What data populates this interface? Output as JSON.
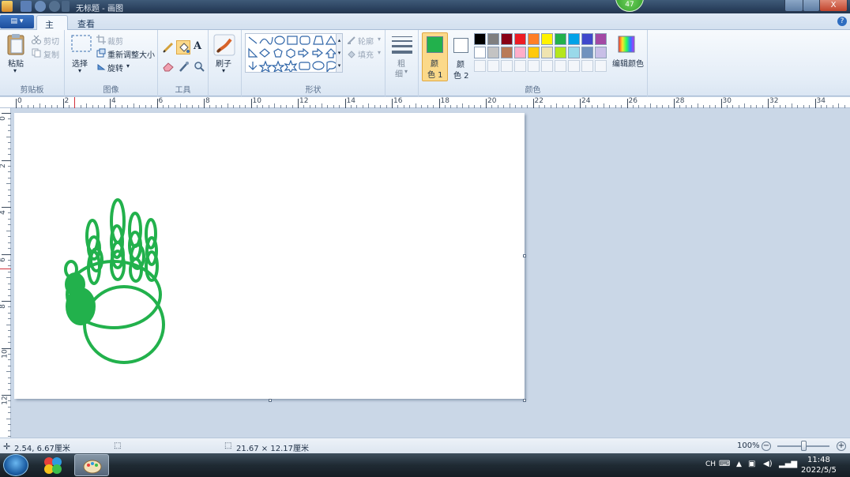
{
  "window": {
    "title": "无标题 - 画图",
    "notification_count": "47",
    "close_label": "X"
  },
  "app_menu_label": "▤ ▾",
  "tabs": [
    {
      "label": "主页"
    },
    {
      "label": "查看"
    }
  ],
  "help_label": "?",
  "ribbon": {
    "clipboard": {
      "paste": "粘贴",
      "cut": "剪切",
      "copy": "复制",
      "label": "剪贴板"
    },
    "image": {
      "select": "选择",
      "crop": "裁剪",
      "resize": "重新调整大小",
      "rotate": "旋转",
      "label": "图像"
    },
    "tools": {
      "label": "工具"
    },
    "brushes": {
      "label": "刷子"
    },
    "shapes": {
      "outline": "轮廓",
      "fill": "填充",
      "label": "形状"
    },
    "size": {
      "label_line1": "粗",
      "label_line2": "细"
    },
    "colors": {
      "color1_line1": "颜",
      "color1_line2": "色 1",
      "color2_line1": "颜",
      "color2_line2": "色 2",
      "edit": "编辑颜色",
      "label": "颜色",
      "color1": "#22b14c",
      "color2": "#ffffff",
      "palette_row1": [
        "#000000",
        "#7f7f7f",
        "#880015",
        "#ed1c24",
        "#ff7f27",
        "#fff200",
        "#22b14c",
        "#00a2e8",
        "#3f48cc",
        "#a349a4"
      ],
      "palette_row2": [
        "#ffffff",
        "#c3c3c3",
        "#b97a57",
        "#ffaec9",
        "#ffc90e",
        "#efe4b0",
        "#b5e61d",
        "#99d9ea",
        "#7092be",
        "#c8bfe7"
      ]
    }
  },
  "ruler": {
    "h_labels": [
      "0",
      "2",
      "4",
      "6",
      "8",
      "10",
      "12",
      "14",
      "16",
      "18",
      "20",
      "22",
      "24",
      "26",
      "28",
      "30",
      "32",
      "34"
    ],
    "v_labels": [
      "0",
      "2",
      "4",
      "6",
      "8",
      "10",
      "12"
    ]
  },
  "drawing": {
    "stroke_color": "#22b14c"
  },
  "status": {
    "cursor_pos": "2.54, 6.67厘米",
    "image_size": "21.67 × 12.17厘米",
    "zoom": "100%"
  },
  "taskbar": {
    "lang": "CH",
    "time": "11:48",
    "date": "2022/5/5"
  }
}
